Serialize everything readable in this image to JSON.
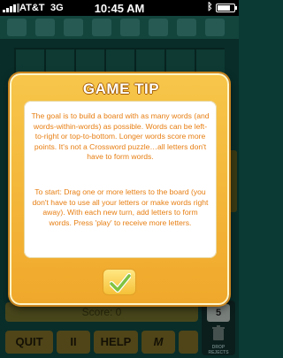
{
  "status_bar": {
    "carrier": "AT&T",
    "network": "3G",
    "time": "10:45 AM"
  },
  "game": {
    "score_label": "Score: 0",
    "drop_count": "5",
    "drop_label": "DROP REJECTS",
    "buttons": {
      "quit": "QUIT",
      "pause": "II",
      "help": "HELP",
      "logo": "M"
    }
  },
  "dialog": {
    "title": "GAME TIP",
    "paragraph_1": "The goal is to build a board with as many words (and words-within-words) as possible. Words can be left-to-right or top-to-bottom. Longer words score more points. It's not a Crossword puzzle…all letters don't have to form words.",
    "paragraph_2": "To start: Drag one or more letters to the board (you don't have to use all your letters or make words right away). With each new turn, add letters to form words. Press 'play' to receive more letters.",
    "ok_icon": "checkmark-icon"
  },
  "colors": {
    "dialog_bg": "#f0a82b",
    "tip_text": "#e77e12",
    "checkmark": "#7fc241"
  }
}
